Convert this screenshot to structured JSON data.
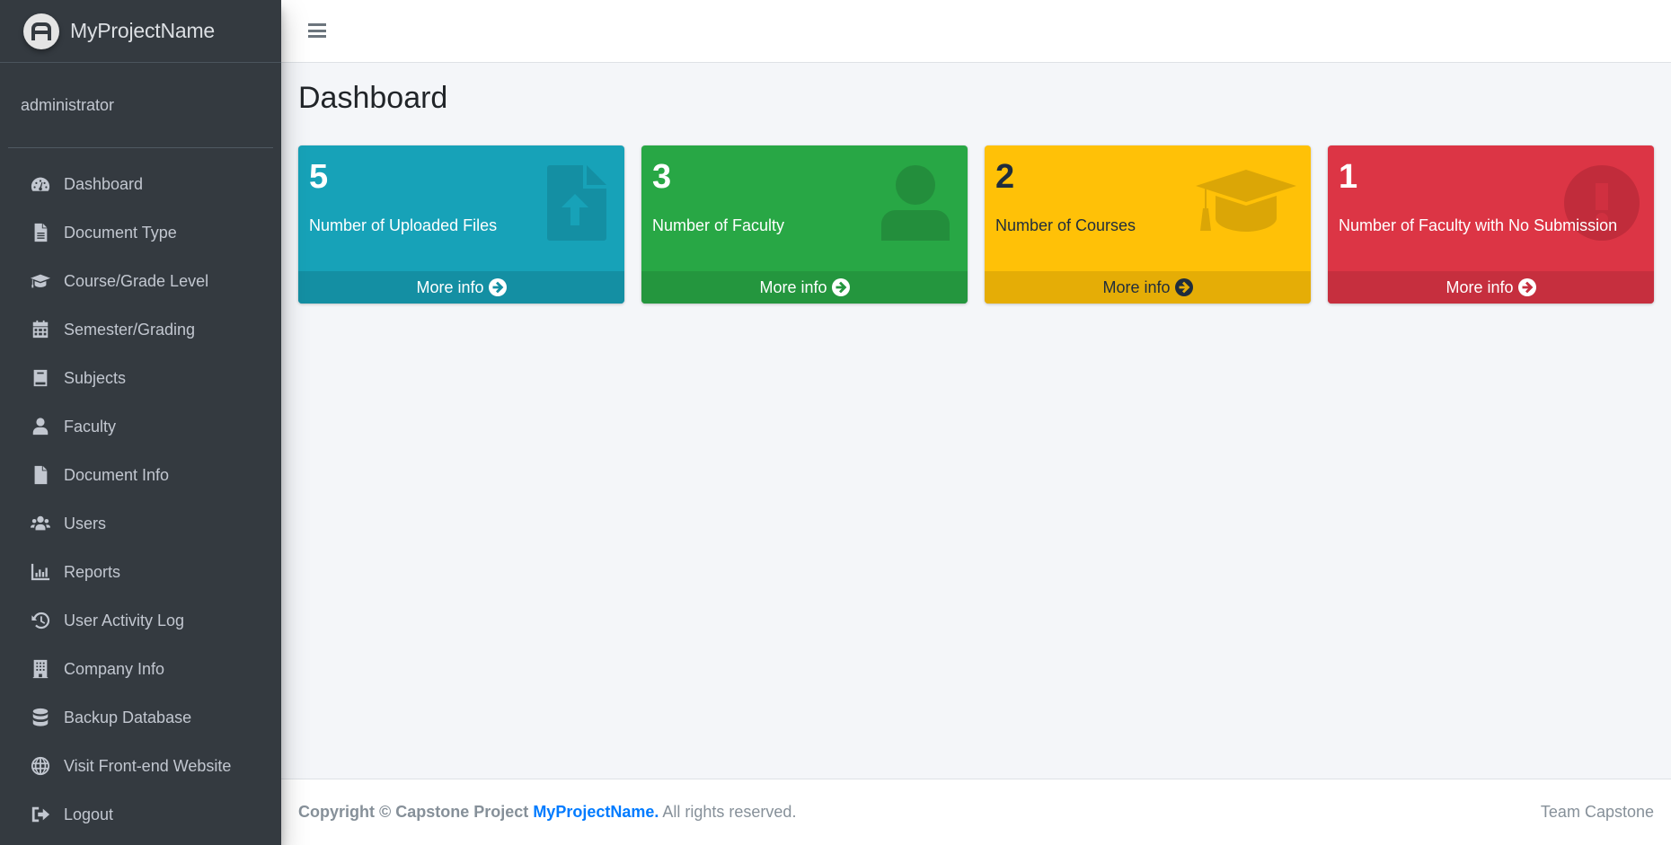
{
  "brand": {
    "name": "MyProjectName",
    "logo_icon": "circle-letter-a-logo"
  },
  "user": {
    "name": "administrator"
  },
  "sidebar": {
    "items": [
      {
        "label": "Dashboard",
        "icon": "tachometer-icon"
      },
      {
        "label": "Document Type",
        "icon": "file-text-icon"
      },
      {
        "label": "Course/Grade Level",
        "icon": "graduation-cap-icon"
      },
      {
        "label": "Semester/Grading",
        "icon": "calendar-icon"
      },
      {
        "label": "Subjects",
        "icon": "book-icon"
      },
      {
        "label": "Faculty",
        "icon": "user-icon"
      },
      {
        "label": "Document Info",
        "icon": "file-icon"
      },
      {
        "label": "Users",
        "icon": "users-icon"
      },
      {
        "label": "Reports",
        "icon": "bar-chart-icon"
      },
      {
        "label": "User Activity Log",
        "icon": "history-icon"
      },
      {
        "label": "Company Info",
        "icon": "building-icon"
      },
      {
        "label": "Backup Database",
        "icon": "database-icon"
      },
      {
        "label": "Visit Front-end Website",
        "icon": "globe-icon"
      },
      {
        "label": "Logout",
        "icon": "sign-out-icon"
      }
    ]
  },
  "header": {
    "menu_toggle_icon": "hamburger-icon"
  },
  "main": {
    "title": "Dashboard",
    "cards": [
      {
        "value": "5",
        "label": "Number of Uploaded Files",
        "link": "More info",
        "icon": "file-upload-icon",
        "color": "#17a2b8"
      },
      {
        "value": "3",
        "label": "Number of Faculty",
        "link": "More info",
        "icon": "user-icon",
        "color": "#28a745"
      },
      {
        "value": "2",
        "label": "Number of Courses",
        "link": "More info",
        "icon": "graduation-cap-icon",
        "color": "#ffc107"
      },
      {
        "value": "1",
        "label": "Number of Faculty with No Submission",
        "link": "More info",
        "icon": "exclamation-circle-icon",
        "color": "#dc3545"
      }
    ]
  },
  "footer": {
    "copyright_prefix": "Copyright © Capstone Project",
    "project_link": "MyProjectName.",
    "rights": "All rights reserved.",
    "team": "Team Capstone"
  }
}
